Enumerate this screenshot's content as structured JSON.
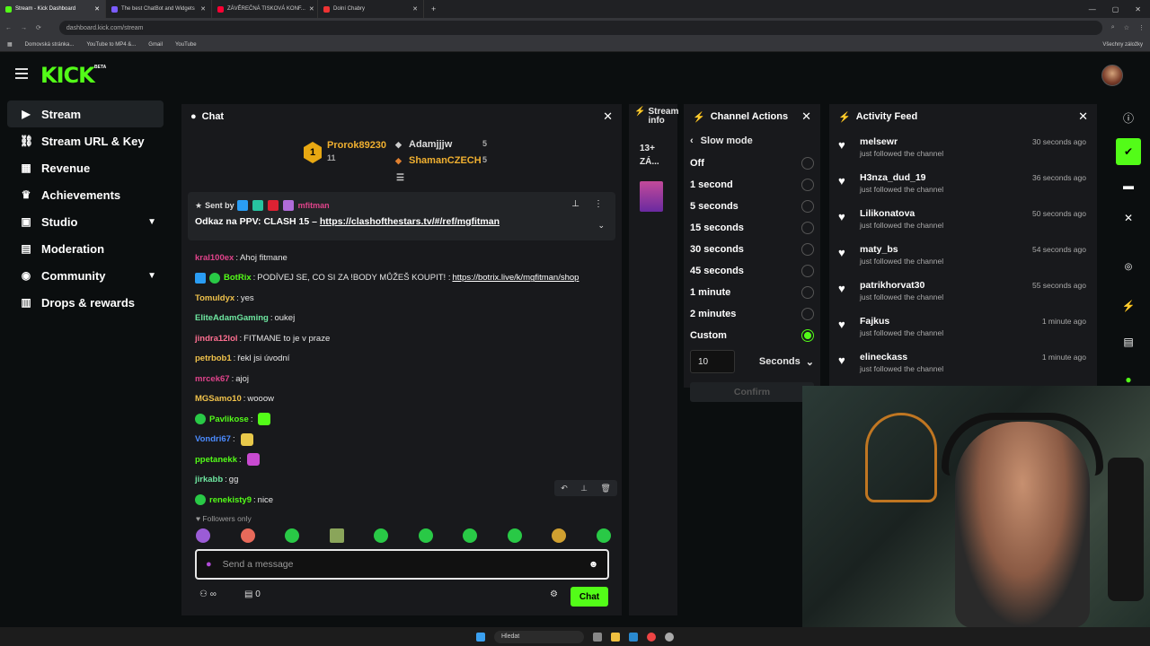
{
  "browser": {
    "tabs": [
      {
        "title": "Stream - Kick Dashboard",
        "active": true
      },
      {
        "title": "The best ChatBot and Widgets",
        "active": false
      },
      {
        "title": "ZÁVĚREČNÁ TISKOVÁ KONF...",
        "active": false
      },
      {
        "title": "Dolní Chabry",
        "active": false
      }
    ],
    "url": "dashboard.kick.com/stream",
    "bookmarks": [
      "Domovská stránka...",
      "YouTube to MP4 &...",
      "Gmail",
      "YouTube"
    ],
    "bookmarks_right": "Všechny záložky"
  },
  "brand": {
    "logo": "KICK",
    "beta": "BETA"
  },
  "sidebar": [
    {
      "label": "Stream",
      "icon": "stream-icon",
      "glyph": "▶"
    },
    {
      "label": "Stream URL & Key",
      "icon": "link-icon",
      "glyph": "🔗"
    },
    {
      "label": "Revenue",
      "icon": "revenue-icon",
      "glyph": "▦"
    },
    {
      "label": "Achievements",
      "icon": "trophy-icon",
      "glyph": "🏆"
    },
    {
      "label": "Studio",
      "icon": "studio-icon",
      "glyph": "▣"
    },
    {
      "label": "Moderation",
      "icon": "moderation-icon",
      "glyph": "▤"
    },
    {
      "label": "Community",
      "icon": "community-icon",
      "glyph": "◉"
    },
    {
      "label": "Drops & rewards",
      "icon": "drops-icon",
      "glyph": "▥"
    }
  ],
  "chat": {
    "title": "Chat",
    "leaderboard": [
      {
        "rank": "1",
        "name": "Prorok89230",
        "count": "11"
      },
      {
        "name": "Adamjjjw",
        "count": "5"
      },
      {
        "name": "ShamanCZECH",
        "count": "5"
      }
    ],
    "pinned": {
      "sent_by": "Sent by",
      "sender": "mfitman",
      "text": "Odkaz na PPV: CLASH 15 – ",
      "link": "https://clashofthestars.tv/#/ref/mgfitman"
    },
    "messages": [
      {
        "user": "kral100ex",
        "text": "Ahoj fitmane",
        "color": "#e0438b"
      },
      {
        "user": "BotRix",
        "text": "PODÍVEJ SE, CO SI ZA !BODY MŮŽEŠ KOUPIT! : ",
        "link": "https://botrix.live/k/mgfitman/shop",
        "color": "#53fc18"
      },
      {
        "user": "Tomuldyx",
        "text": "yes",
        "color": "#f0c24b"
      },
      {
        "user": "EliteAdamGaming",
        "text": "oukej",
        "color": "#6ee6a0"
      },
      {
        "user": "jindra12lol",
        "text": "FITMANE to je v praze",
        "color": "#ff6f91"
      },
      {
        "user": "petrbob1",
        "text": "řekl jsi úvodní",
        "color": "#f0c24b"
      },
      {
        "user": "mrcek67",
        "text": "ajoj",
        "color": "#e0438b"
      },
      {
        "user": "MGSamo10",
        "text": "wooow",
        "color": "#f0c24b"
      },
      {
        "user": "Pavlikose",
        "text": "",
        "color": "#53fc18"
      },
      {
        "user": "Vondri67",
        "text": "",
        "color": "#4b8bff"
      },
      {
        "user": "ppetanekk",
        "text": "",
        "color": "#53fc18"
      },
      {
        "user": "jirkabb",
        "text": "gg",
        "color": "#6ee6a0"
      },
      {
        "user": "renekisty9",
        "text": "nice",
        "color": "#53fc18"
      }
    ],
    "followers_only": "Followers only",
    "input_placeholder": "Send a message",
    "points": "0",
    "send_label": "Chat"
  },
  "stream_info": {
    "title": "Stream info",
    "viewers": "13+",
    "category": "ZÁ..."
  },
  "channel_actions": {
    "title": "Channel Actions",
    "slow_mode": "Slow mode",
    "options": [
      "Off",
      "1 second",
      "5 seconds",
      "15 seconds",
      "30 seconds",
      "45 seconds",
      "1 minute",
      "2 minutes",
      "Custom"
    ],
    "selected": "Custom",
    "custom_value": "10",
    "unit": "Seconds",
    "confirm": "Confirm"
  },
  "activity_feed": {
    "title": "Activity Feed",
    "items": [
      {
        "name": "melsewr",
        "sub": "just followed the channel",
        "time": "30 seconds ago"
      },
      {
        "name": "H3nza_dud_19",
        "sub": "just followed the channel",
        "time": "36 seconds ago"
      },
      {
        "name": "Lilikonatova",
        "sub": "just followed the channel",
        "time": "50 seconds ago"
      },
      {
        "name": "maty_bs",
        "sub": "just followed the channel",
        "time": "54 seconds ago"
      },
      {
        "name": "patrikhorvat30",
        "sub": "just followed the channel",
        "time": "55 seconds ago"
      },
      {
        "name": "Fajkus",
        "sub": "just followed the channel",
        "time": "1 minute ago"
      },
      {
        "name": "elineckass",
        "sub": "just followed the channel",
        "time": "1 minute ago"
      }
    ]
  },
  "taskbar": {
    "search": "Hledat"
  },
  "colors": {
    "accent": "#53fc18",
    "panel": "#18191c",
    "bg": "#0b0e0f"
  }
}
